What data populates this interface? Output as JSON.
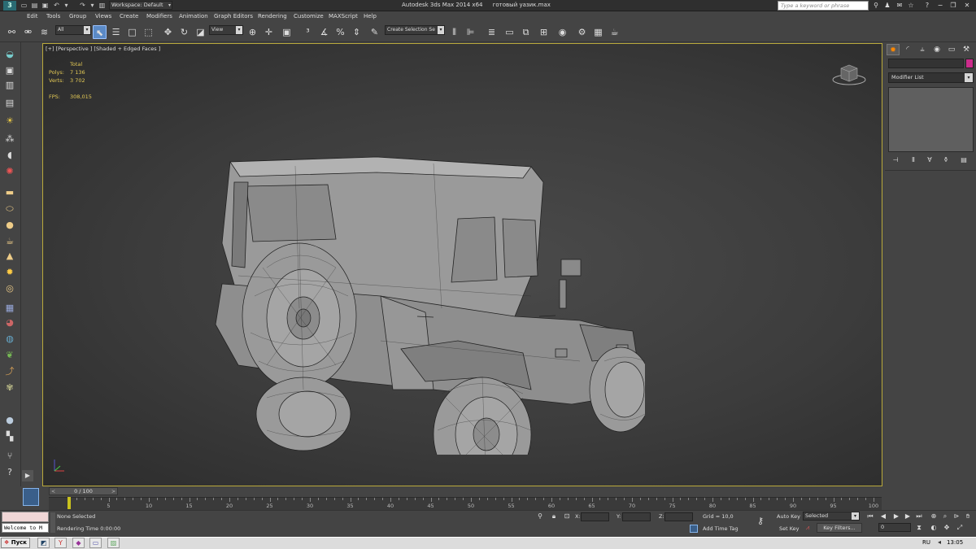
{
  "window": {
    "title": "Autodesk 3ds Max  2014 x64",
    "file": "готовый уазик.max",
    "workspace": "Workspace: Default",
    "help_search_placeholder": "Type a keyword or phrase"
  },
  "menu": [
    "Edit",
    "Tools",
    "Group",
    "Views",
    "Create",
    "Modifiers",
    "Animation",
    "Graph Editors",
    "Rendering",
    "Customize",
    "MAXScript",
    "Help"
  ],
  "toolbar": {
    "selection_filter": "All",
    "reference_coord": "View",
    "named_selection": "Create Selection Se"
  },
  "viewport": {
    "label": "[+] [Perspective ] [Shaded + Edged Faces ]",
    "stats": {
      "header": "Total",
      "polys_label": "Polys:",
      "polys": "7 136",
      "verts_label": "Verts:",
      "verts": "3 702",
      "fps_label": "FPS:",
      "fps": "308,015"
    }
  },
  "command_panel": {
    "modifier_list": "Modifier List",
    "object_color": "#cc2c8c"
  },
  "timeline": {
    "position": "0 / 100",
    "current_frame": 0,
    "ticks": [
      "0",
      "5",
      "10",
      "15",
      "20",
      "25",
      "30",
      "35",
      "40",
      "45",
      "50",
      "55",
      "60",
      "65",
      "70",
      "75",
      "80",
      "85",
      "90",
      "95",
      "100"
    ]
  },
  "status": {
    "selection": "None Selected",
    "rendering_time": "Rendering Time  0:00:00",
    "x_label": "X:",
    "y_label": "Y:",
    "z_label": "Z:",
    "grid": "Grid = 10,0",
    "add_time_tag": "Add Time Tag",
    "auto_key": "Auto Key",
    "set_key": "Set Key",
    "selected": "Selected",
    "key_filters": "Key Filters...",
    "frame": "0",
    "maxscript": "Welcome to M"
  },
  "taskbar": {
    "start": "Пуск",
    "language": "RU",
    "clock": "13:05"
  }
}
